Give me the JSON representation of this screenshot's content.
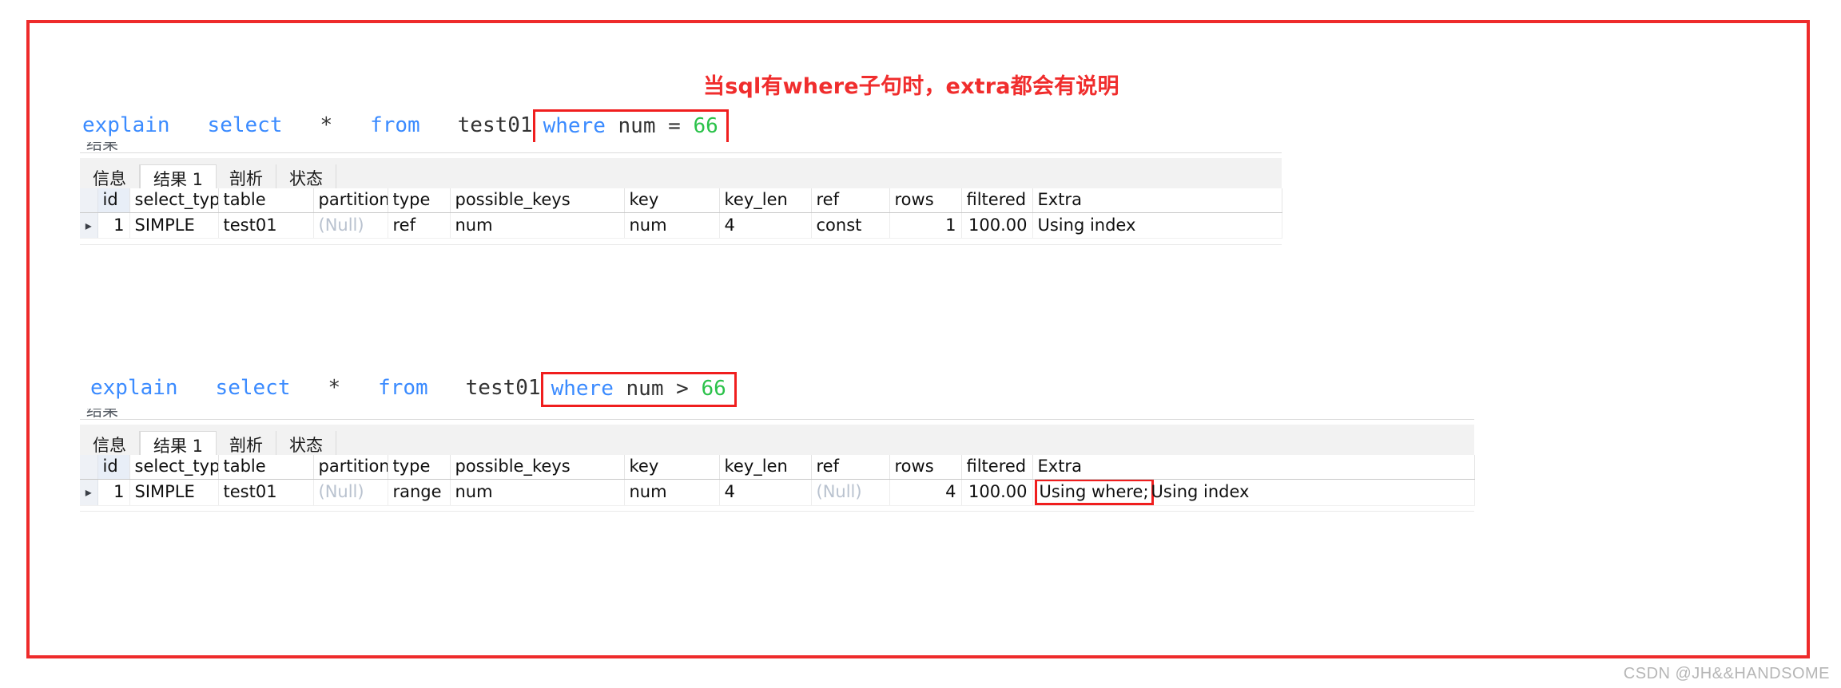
{
  "annotation": {
    "title": "当sql有where子句时，extra都会有说明",
    "title_color": "#f02d2d",
    "frame_color": "#ee2b2b",
    "highlight_color": "#f01e1e"
  },
  "watermark": "CSDN @JH&&HANDSOME",
  "blocks": [
    {
      "sql": {
        "explain": "explain",
        "select": "select",
        "star": "*",
        "from": "from",
        "table": "test01",
        "where_kw": "where",
        "where_col": "num",
        "where_op": "=",
        "where_val": "66"
      },
      "clipped_text": "结果",
      "tabs": [
        {
          "label": "信息",
          "active": false
        },
        {
          "label": "结果 1",
          "active": true
        },
        {
          "label": "剖析",
          "active": false
        },
        {
          "label": "状态",
          "active": false
        }
      ],
      "columns": [
        "id",
        "select_type",
        "table",
        "partitions",
        "type",
        "possible_keys",
        "key",
        "key_len",
        "ref",
        "rows",
        "filtered",
        "Extra"
      ],
      "row": {
        "marker": "▸",
        "id": "1",
        "select_type": "SIMPLE",
        "table": "test01",
        "partitions": "(Null)",
        "type": "ref",
        "possible_keys": "num",
        "key": "num",
        "key_len": "4",
        "ref": "const",
        "rows": "1",
        "filtered": "100.00",
        "extra_highlighted": "",
        "extra_rest": "Using index"
      }
    },
    {
      "sql": {
        "explain": "explain",
        "select": "select",
        "star": "*",
        "from": "from",
        "table": "test01",
        "where_kw": "where",
        "where_col": "num",
        "where_op": ">",
        "where_val": "66"
      },
      "clipped_text": "结果",
      "tabs": [
        {
          "label": "信息",
          "active": false
        },
        {
          "label": "结果 1",
          "active": true
        },
        {
          "label": "剖析",
          "active": false
        },
        {
          "label": "状态",
          "active": false
        }
      ],
      "columns": [
        "id",
        "select_type",
        "table",
        "partitions",
        "type",
        "possible_keys",
        "key",
        "key_len",
        "ref",
        "rows",
        "filtered",
        "Extra"
      ],
      "row": {
        "marker": "▸",
        "id": "1",
        "select_type": "SIMPLE",
        "table": "test01",
        "partitions": "(Null)",
        "type": "range",
        "possible_keys": "num",
        "key": "num",
        "key_len": "4",
        "ref": "(Null)",
        "rows": "4",
        "filtered": "100.00",
        "extra_highlighted": "Using where;",
        "extra_rest": "Using index"
      }
    }
  ]
}
